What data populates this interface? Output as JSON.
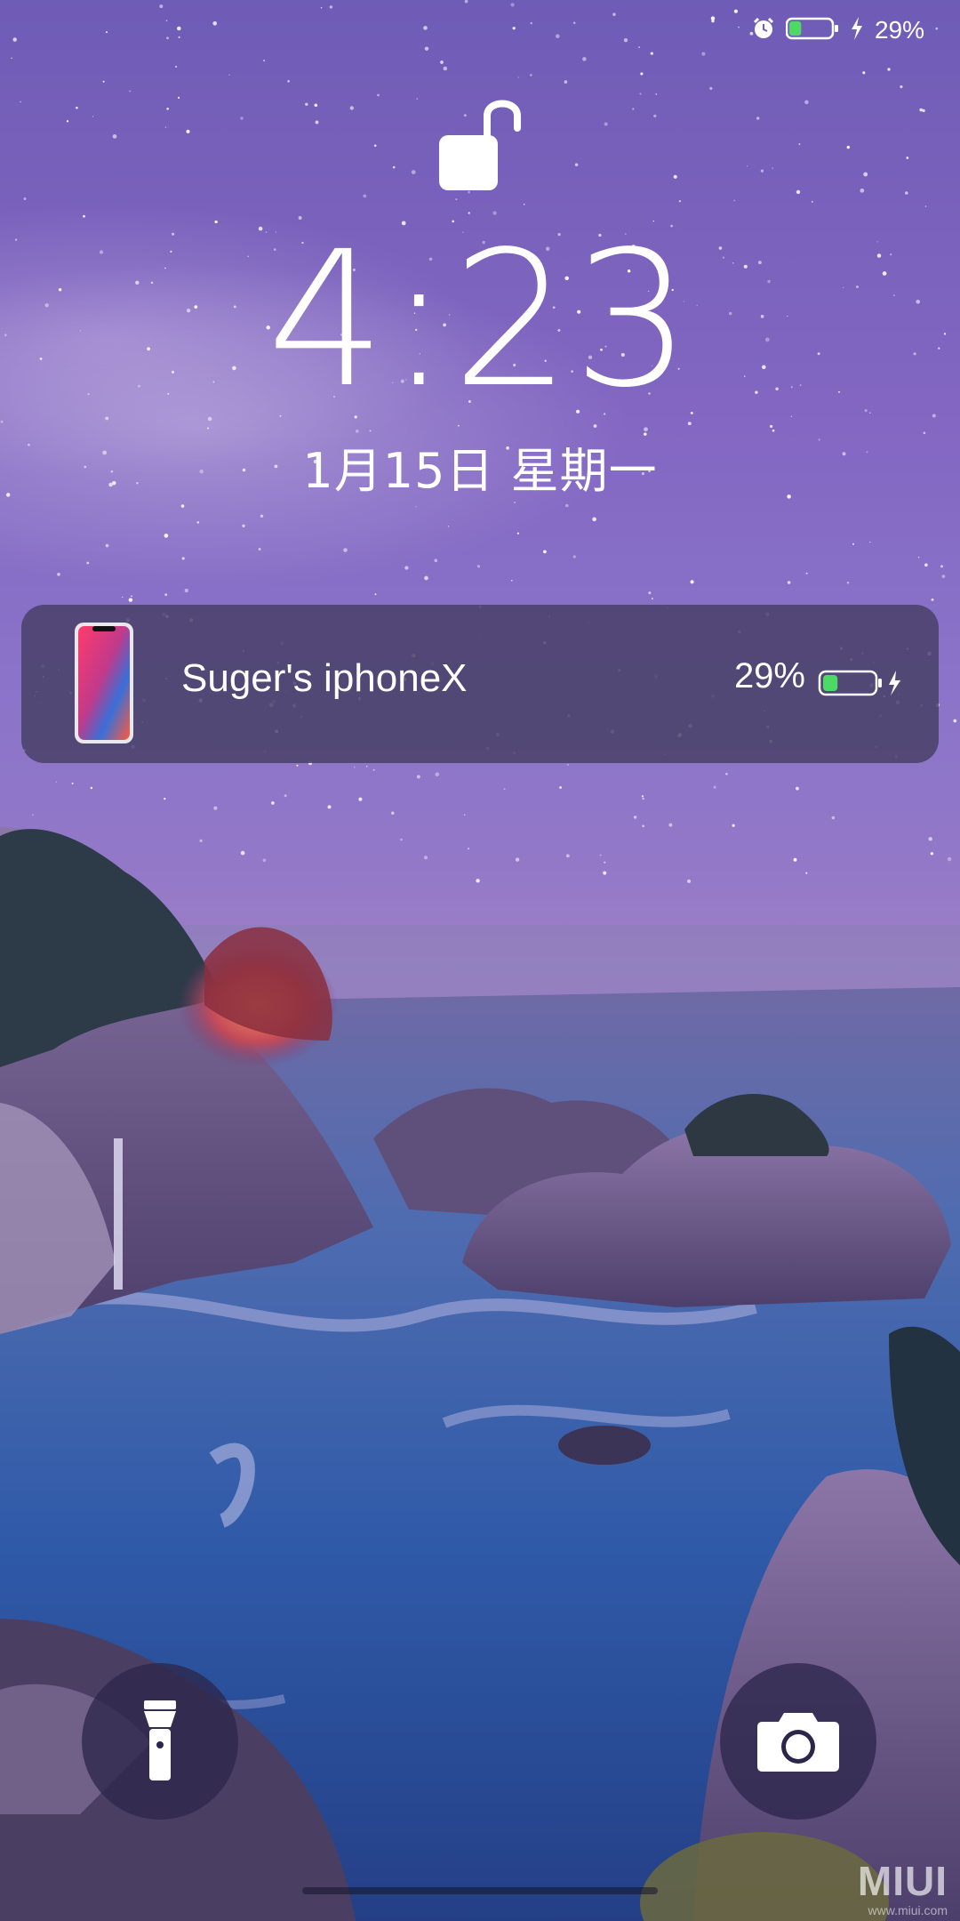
{
  "status_bar": {
    "battery_percent": "29%",
    "battery_level": 0.29,
    "icons": [
      "alarm-icon",
      "battery-icon",
      "charging-icon"
    ]
  },
  "lockscreen": {
    "lock_state_icon": "unlocked-padlock-icon",
    "time": "4:23",
    "date": "1月15日 星期一"
  },
  "device_card": {
    "device_icon": "iphone-x-icon",
    "device_name": "Suger's iphoneX",
    "battery_percent": "29%",
    "battery_level": 0.29,
    "charging": true,
    "battery_color": "#4cd964"
  },
  "shortcuts": {
    "left": "flashlight-icon",
    "right": "camera-icon"
  },
  "watermark": {
    "brand": "MIUI",
    "url": "www.miui.com"
  }
}
